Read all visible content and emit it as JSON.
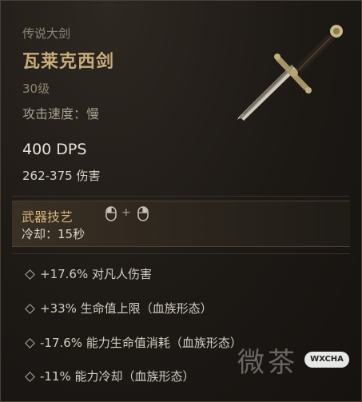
{
  "item": {
    "type": "传说大剑",
    "name": "瓦莱克西剑",
    "level": "30级",
    "attack_speed": "攻击速度：慢",
    "dps": "400 DPS",
    "damage": "262-375 伤害"
  },
  "skill": {
    "title": "武器技艺",
    "plus": "+",
    "cooldown": "冷却：15秒"
  },
  "affixes": [
    "+17.6% 对凡人伤害",
    "+33% 生命值上限（血族形态）",
    "-17.6% 能力生命值消耗（血族形态）",
    "-11% 能力冷却（血族形态）"
  ],
  "watermark": {
    "text": "微茶",
    "badge": "WXCHA"
  },
  "colors": {
    "name": "#c9ad7c",
    "skill_title": "#d7b57d",
    "background": "#1a1612"
  },
  "icons": [
    "greatsword-icon",
    "mouse-left-icon",
    "mouse-right-icon",
    "diamond-bullet-icon"
  ]
}
